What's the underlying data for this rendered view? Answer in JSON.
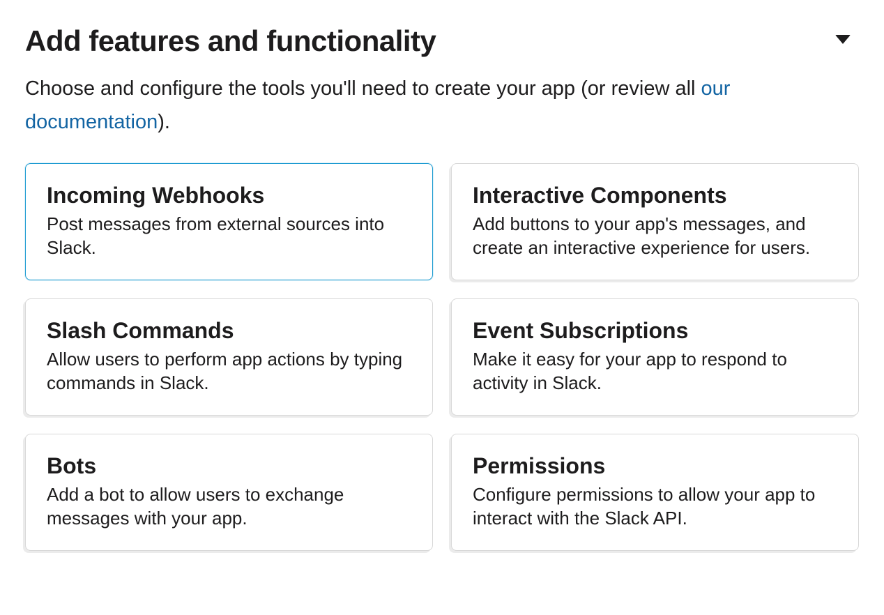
{
  "section": {
    "title": "Add features and functionality",
    "intro_prefix": "Choose and configure the tools you'll need to create your app (or review all ",
    "intro_link": "our documentation",
    "intro_suffix": ")."
  },
  "cards": [
    {
      "title": "Incoming Webhooks",
      "desc": "Post messages from external sources into Slack.",
      "selected": true
    },
    {
      "title": "Interactive Components",
      "desc": "Add buttons to your app's messages, and create an interactive experience for users.",
      "selected": false
    },
    {
      "title": "Slash Commands",
      "desc": "Allow users to perform app actions by typing commands in Slack.",
      "selected": false
    },
    {
      "title": "Event Subscriptions",
      "desc": "Make it easy for your app to respond to activity in Slack.",
      "selected": false
    },
    {
      "title": "Bots",
      "desc": "Add a bot to allow users to exchange messages with your app.",
      "selected": false
    },
    {
      "title": "Permissions",
      "desc": "Configure permissions to allow your app to interact with the Slack API.",
      "selected": false
    }
  ]
}
